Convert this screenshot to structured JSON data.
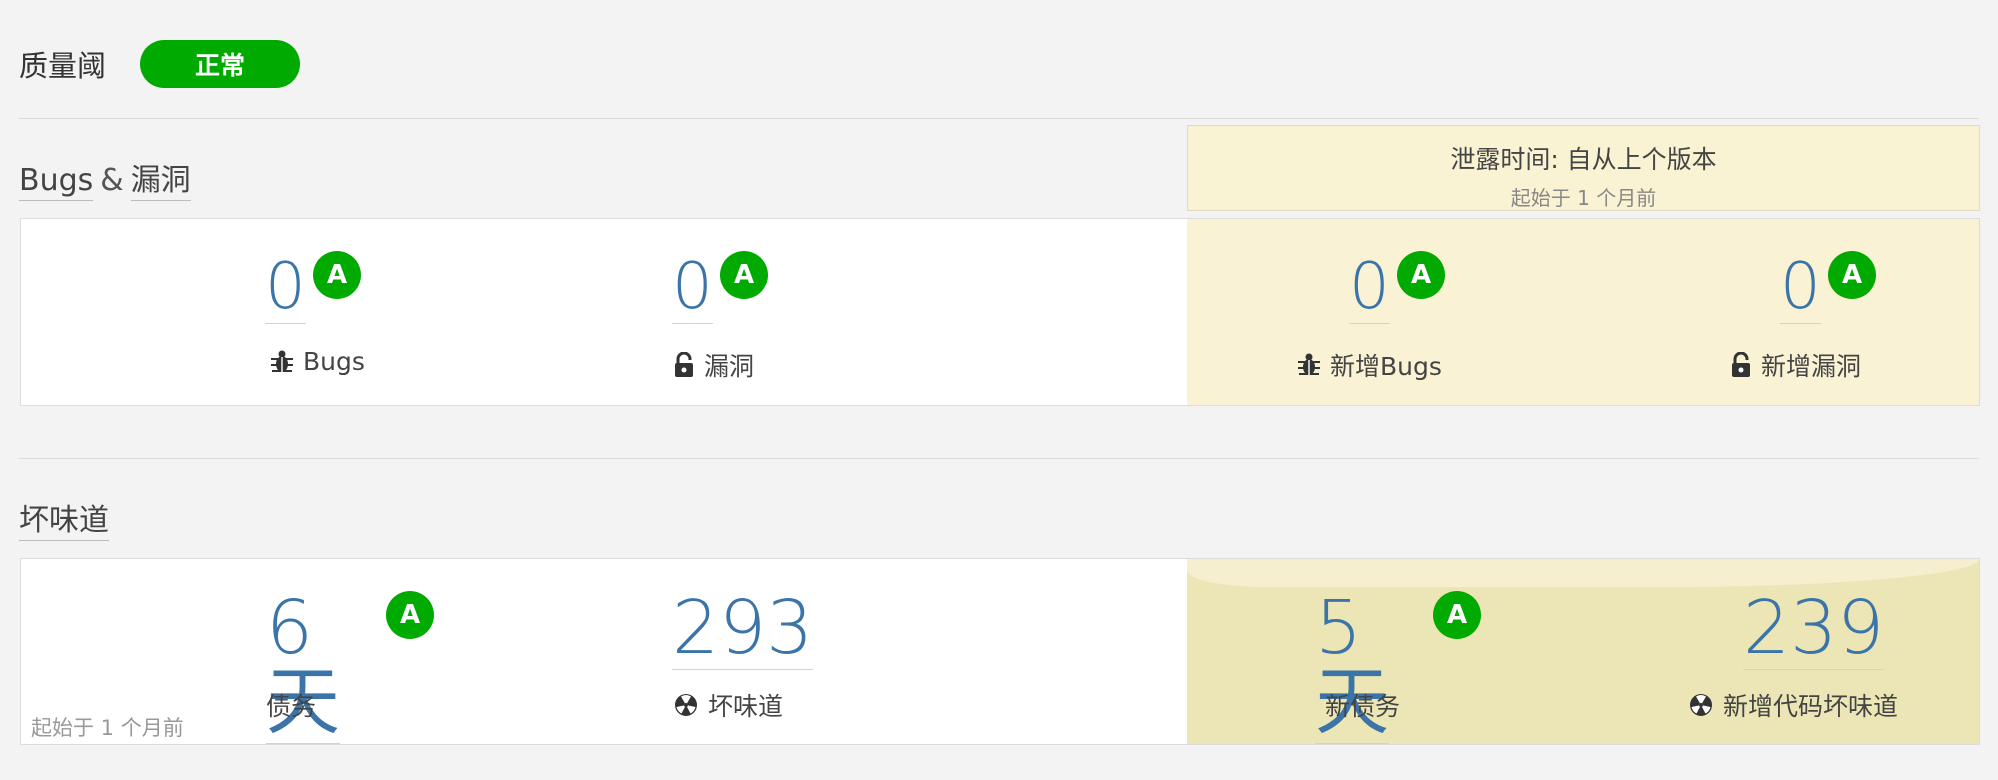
{
  "quality_gate": {
    "label": "质量阈",
    "status": "正常",
    "status_color": "#00aa00"
  },
  "leak_period": {
    "title": "泄露时间: 自从上个版本",
    "subtitle": "起始于 1 个月前"
  },
  "bugs_section": {
    "title_left": "Bugs",
    "title_amp": "&",
    "title_right": "漏洞",
    "metrics": [
      {
        "value": "0",
        "rating": "A",
        "label": "Bugs",
        "icon": "bug-icon"
      },
      {
        "value": "0",
        "rating": "A",
        "label": "漏洞",
        "icon": "lock-icon"
      },
      {
        "value": "0",
        "rating": "A",
        "label": "新增Bugs",
        "icon": "bug-icon"
      },
      {
        "value": "0",
        "rating": "A",
        "label": "新增漏洞",
        "icon": "lock-icon"
      }
    ]
  },
  "smells_section": {
    "title": "坏味道",
    "since": "起始于 1 个月前",
    "metrics": [
      {
        "value": "6天",
        "rating": "A",
        "label": "债务"
      },
      {
        "value": "293",
        "label": "坏味道",
        "icon": "radiation-icon"
      },
      {
        "value": "5天",
        "rating": "A",
        "label": "新债务"
      },
      {
        "value": "239",
        "label": "新增代码坏味道",
        "icon": "radiation-icon"
      }
    ]
  },
  "colors": {
    "rating_a": "#00aa00",
    "metric_value": "#3b74a8",
    "leak_bg": "#f9f2d4"
  }
}
